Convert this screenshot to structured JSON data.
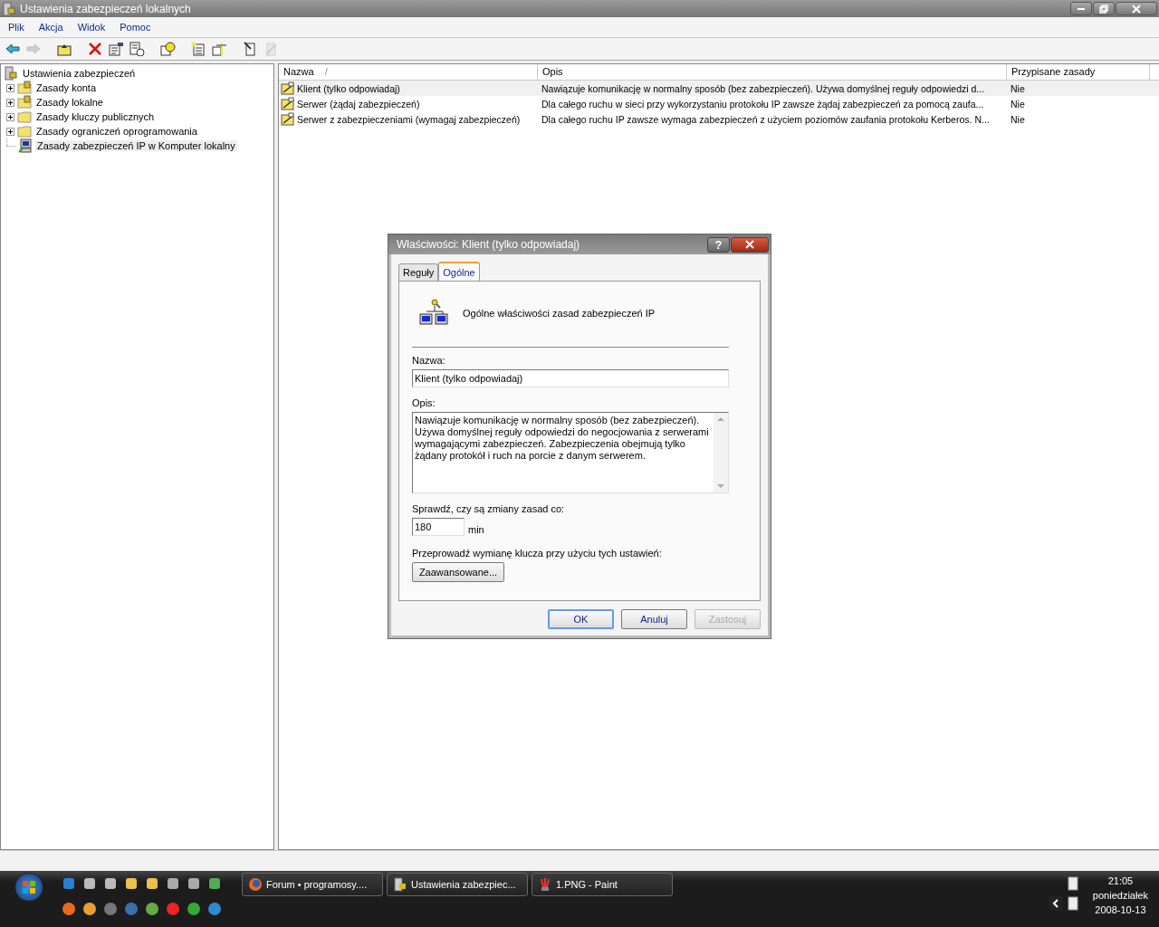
{
  "window": {
    "title": "Ustawienia zabezpieczeń lokalnych"
  },
  "menu": [
    "Plik",
    "Akcja",
    "Widok",
    "Pomoc"
  ],
  "toolbar": [
    {
      "kind": "back",
      "disabled": false
    },
    {
      "kind": "forward",
      "disabled": true
    },
    {
      "kind": "sep"
    },
    {
      "kind": "up",
      "disabled": false
    },
    {
      "kind": "sep"
    },
    {
      "kind": "delete",
      "disabled": false
    },
    {
      "kind": "properties",
      "disabled": false
    },
    {
      "kind": "export",
      "disabled": false
    },
    {
      "kind": "sep"
    },
    {
      "kind": "help",
      "disabled": false
    },
    {
      "kind": "sep"
    },
    {
      "kind": "new",
      "disabled": false
    },
    {
      "kind": "assign",
      "disabled": false
    },
    {
      "kind": "sep"
    },
    {
      "kind": "policy",
      "disabled": false
    },
    {
      "kind": "unassign",
      "disabled": true
    }
  ],
  "tree": {
    "label": "Ustawienia zabezpieczeń",
    "selected": false,
    "children": [
      {
        "label": "Zasady konta",
        "kind": "lockfolder",
        "expanded": false,
        "selected": false
      },
      {
        "label": "Zasady lokalne",
        "kind": "lockfolder",
        "expanded": false,
        "selected": false
      },
      {
        "label": "Zasady kluczy publicznych",
        "kind": "folder",
        "expanded": false,
        "selected": false
      },
      {
        "label": "Zasady ograniczeń oprogramowania",
        "kind": "folder",
        "expanded": false,
        "selected": false
      },
      {
        "label": "Zasady zabezpieczeń IP w Komputer lokalny",
        "kind": "computer",
        "selected": true
      }
    ]
  },
  "table": {
    "columns": [
      "Nazwa",
      "Opis",
      "Przypisane zasady"
    ],
    "sort_mark": "/",
    "rows": [
      {
        "name": "Klient (tylko odpowiadaj)",
        "description": "Nawiązuje komunikację w normalny sposób (bez zabezpieczeń). Używa domyślnej reguły odpowiedzi d...",
        "assigned": "Nie",
        "selected": true
      },
      {
        "name": "Serwer (żądaj zabezpieczeń)",
        "description": "Dla całego ruchu w sieci przy wykorzystaniu protokołu IP zawsze żądaj zabezpieczeń za pomocą zaufa...",
        "assigned": "Nie",
        "selected": false
      },
      {
        "name": "Serwer z zabezpieczeniami (wymagaj zabezpieczeń)",
        "description": "Dla całego ruchu IP zawsze wymaga zabezpieczeń z użyciem poziomów zaufania protokołu Kerberos. N...",
        "assigned": "Nie",
        "selected": false
      }
    ]
  },
  "dialog": {
    "title": "Właściwości: Klient (tylko odpowiadaj)",
    "help_button": "?",
    "tabs": [
      {
        "label": "Reguły",
        "selected": false
      },
      {
        "label": "Ogólne",
        "selected": true
      }
    ],
    "heading": "Ogólne właściwości zasad zabezpieczeń IP",
    "name_label": "Nazwa:",
    "name_value": "Klient (tylko odpowiadaj)",
    "description_label": "Opis:",
    "description_value": "Nawiązuje komunikację w normalny sposób (bez zabezpieczeń). Używa domyślnej reguły odpowiedzi do negocjowania z serwerami wymagającymi zabezpieczeń. Zabezpieczenia obejmują tylko żądany protokół i ruch na porcie z danym serwerem.",
    "interval_label": "Sprawdź, czy są zmiany zasad co:",
    "interval_value": "180",
    "interval_unit": "min",
    "key_exchange_label": "Przeprowadź wymianę klucza przy użyciu tych ustawień:",
    "advanced_button": "Zaawansowane...",
    "buttons": [
      {
        "label": "OK",
        "disabled": false,
        "default": true
      },
      {
        "label": "Anuluj",
        "disabled": false,
        "default": false
      },
      {
        "label": "Zastosuj",
        "disabled": true,
        "default": false
      }
    ]
  },
  "taskbar": {
    "tasks": [
      {
        "label": "Forum • programosy....",
        "kind": "browser"
      },
      {
        "label": "Ustawienia zabezpiec...",
        "kind": "security"
      },
      {
        "label": "1.PNG - Paint",
        "kind": "paint"
      }
    ],
    "clock": {
      "time": "21:05",
      "day": "poniedziałek",
      "date": "2008-10-13"
    }
  }
}
